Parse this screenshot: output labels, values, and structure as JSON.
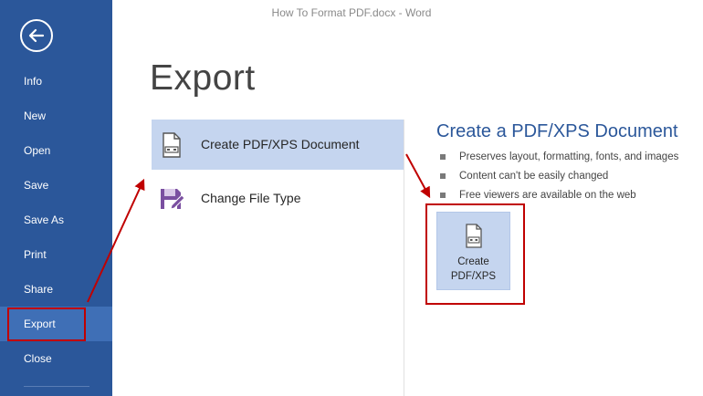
{
  "window": {
    "title": "How To Format PDF.docx - Word"
  },
  "sidebar": {
    "back_icon": "back-arrow-circle-icon",
    "items": [
      {
        "label": "Info",
        "selected": false
      },
      {
        "label": "New",
        "selected": false
      },
      {
        "label": "Open",
        "selected": false
      },
      {
        "label": "Save",
        "selected": false
      },
      {
        "label": "Save As",
        "selected": false
      },
      {
        "label": "Print",
        "selected": false
      },
      {
        "label": "Share",
        "selected": false
      },
      {
        "label": "Export",
        "selected": true
      },
      {
        "label": "Close",
        "selected": false
      }
    ]
  },
  "main": {
    "title": "Export",
    "options": [
      {
        "label": "Create PDF/XPS Document",
        "icon": "pdf-document-icon",
        "selected": true
      },
      {
        "label": "Change File Type",
        "icon": "file-type-icon",
        "selected": false
      }
    ]
  },
  "detail": {
    "title": "Create a PDF/XPS Document",
    "bullets": [
      "Preserves layout, formatting, fonts, and images",
      "Content can't be easily changed",
      "Free viewers are available on the web"
    ],
    "button": {
      "line1": "Create",
      "line2": "PDF/XPS",
      "icon": "pdf-document-icon"
    }
  },
  "colors": {
    "sidebar": "#2b579a",
    "sidebar_selected": "#3f6fb6",
    "accent": "#2b579a",
    "option_selected": "#c5d5ef",
    "annotation": "#c00000"
  }
}
